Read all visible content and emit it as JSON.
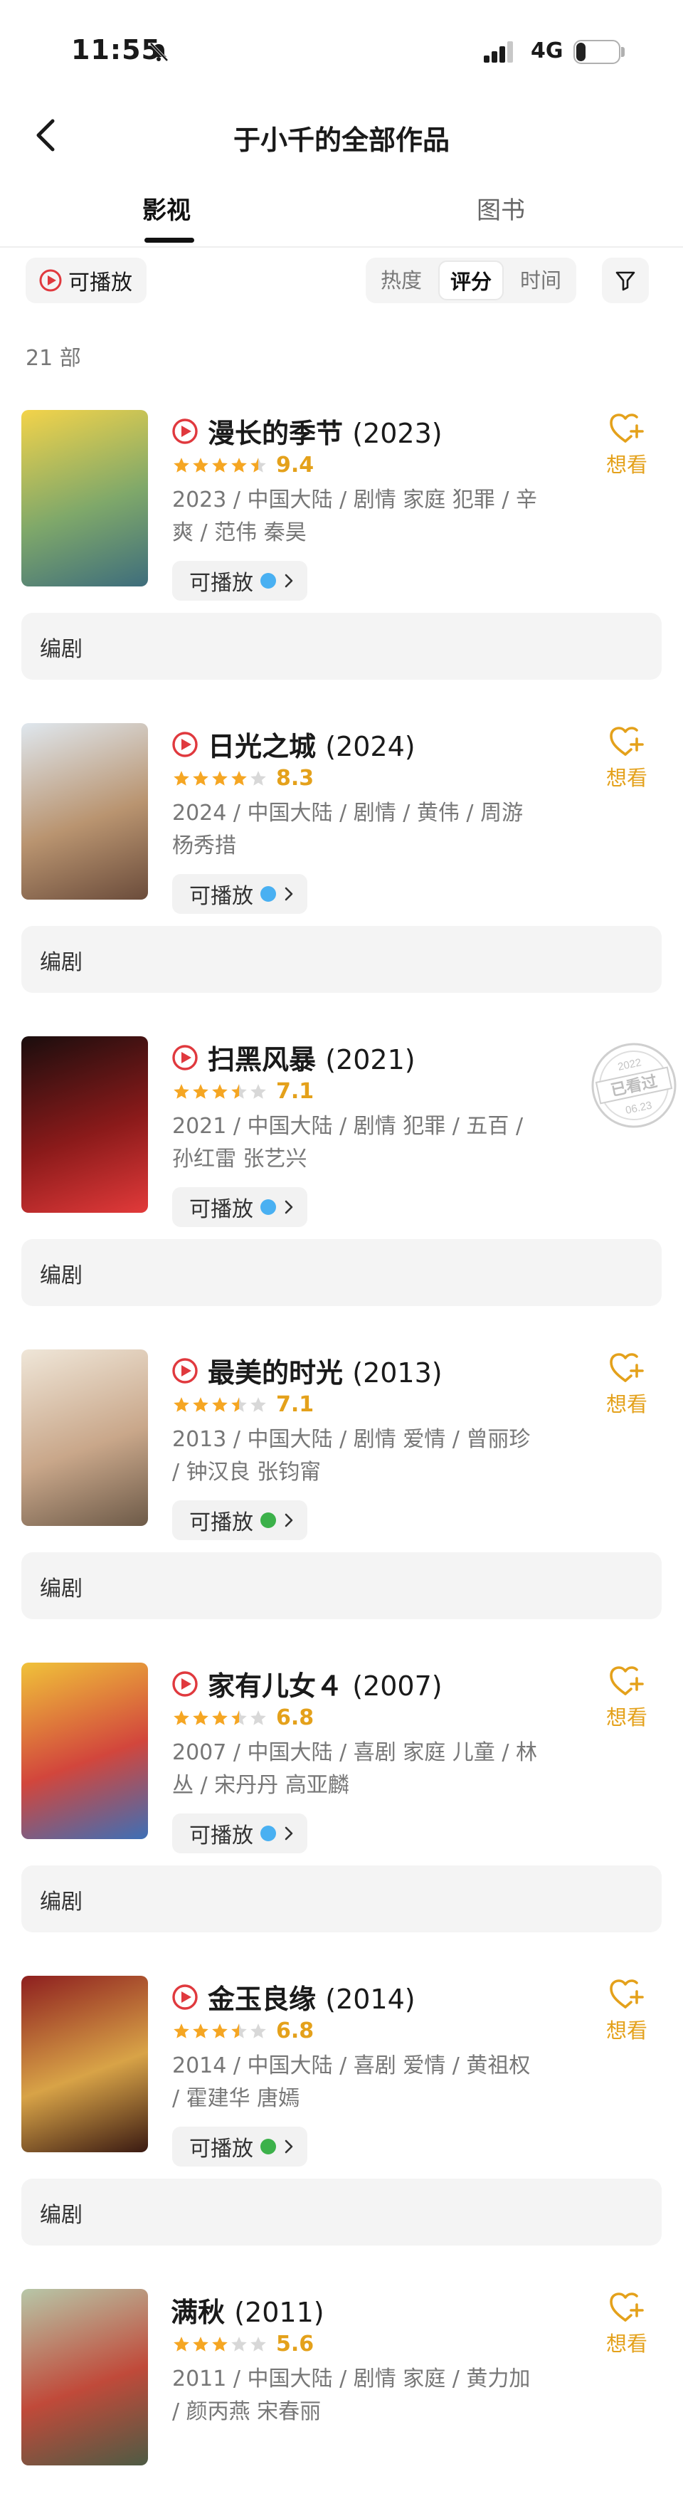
{
  "status_bar": {
    "time": "11:55",
    "network": "4G",
    "battery_level": "22",
    "icons": [
      "bell-slash-icon",
      "signal-icon",
      "battery-icon"
    ]
  },
  "nav": {
    "title": "于小千的全部作品",
    "back_icon": "chevron-left-icon"
  },
  "tabs": [
    {
      "label": "影视",
      "active": true
    },
    {
      "label": "图书",
      "active": false
    }
  ],
  "filter": {
    "playable_label": "可播放",
    "sort_options": [
      "热度",
      "评分",
      "时间"
    ],
    "selected_sort": "评分",
    "filter_icon": "funnel-icon"
  },
  "count_label": "21 部",
  "colors": {
    "accent": "#e4a11b",
    "play_red": "#e0393e",
    "star": "#f5a623",
    "star_empty": "#d8d8d8"
  },
  "works": [
    {
      "title": "漫长的季节",
      "year": "(2023)",
      "score": "9.4",
      "rating": 4.5,
      "meta": "2023 / 中国大陆 / 剧情 家庭 犯罪 / 辛爽 / 范伟 秦昊",
      "play_label": "可播放",
      "source_color": "#49b0f2",
      "show_title_play": true,
      "show_play_chip": true,
      "state": "want",
      "want_label": "想看",
      "role": "编剧",
      "poster_colors": [
        "#f3d34a",
        "#7fa86a",
        "#3e6d7c"
      ]
    },
    {
      "title": "日光之城",
      "year": "(2024)",
      "score": "8.3",
      "rating": 4.0,
      "meta": "2024 / 中国大陆 / 剧情 / 黄伟 / 周游 杨秀措",
      "play_label": "可播放",
      "source_color": "#49b0f2",
      "show_title_play": true,
      "show_play_chip": true,
      "state": "want",
      "want_label": "想看",
      "role": "编剧",
      "poster_colors": [
        "#dfe7ee",
        "#b99470",
        "#6b4c3b"
      ]
    },
    {
      "title": "扫黑风暴",
      "year": "(2021)",
      "score": "7.1",
      "rating": 3.5,
      "meta": "2021 / 中国大陆 / 剧情 犯罪 / 五百 / 孙红雷 张艺兴",
      "play_label": "可播放",
      "source_color": "#49b0f2",
      "show_title_play": true,
      "show_play_chip": true,
      "state": "seen",
      "seen_label": "已看过",
      "seen_year": "2022",
      "seen_date": "06.23",
      "role": "编剧",
      "poster_colors": [
        "#1a0d0d",
        "#8a1a1a",
        "#e23a3a"
      ]
    },
    {
      "title": "最美的时光",
      "year": "(2013)",
      "score": "7.1",
      "rating": 3.5,
      "meta": "2013 / 中国大陆 / 剧情 爱情 / 曾丽珍 / 钟汉良 张钧甯",
      "play_label": "可播放",
      "source_color": "#3cb14a",
      "show_title_play": true,
      "show_play_chip": true,
      "state": "want",
      "want_label": "想看",
      "role": "编剧",
      "poster_colors": [
        "#efe6d8",
        "#c9a78a",
        "#6d5a48"
      ]
    },
    {
      "title": "家有儿女４",
      "year": "(2007)",
      "score": "6.8",
      "rating": 3.5,
      "meta": "2007 / 中国大陆 / 喜剧 家庭 儿童 / 林丛 / 宋丹丹 高亚麟",
      "play_label": "可播放",
      "source_color": "#49b0f2",
      "show_title_play": true,
      "show_play_chip": true,
      "state": "want",
      "want_label": "想看",
      "role": "编剧",
      "poster_colors": [
        "#f0c23a",
        "#d2463c",
        "#3d6fb6"
      ]
    },
    {
      "title": "金玉良缘",
      "year": "(2014)",
      "score": "6.8",
      "rating": 3.5,
      "meta": "2014 / 中国大陆 / 喜剧 爱情 / 黄祖权 / 霍建华 唐嫣",
      "play_label": "可播放",
      "source_color": "#3cb14a",
      "show_title_play": true,
      "show_play_chip": true,
      "state": "want",
      "want_label": "想看",
      "role": "编剧",
      "poster_colors": [
        "#8e1f1f",
        "#d8a347",
        "#3a1a12"
      ]
    },
    {
      "title": "满秋",
      "year": "(2011)",
      "score": "5.6",
      "rating": 3.0,
      "meta": "2011 / 中国大陆 / 剧情 家庭 / 黄力加 / 颜丙燕 宋春丽",
      "play_label": "",
      "source_color": "",
      "show_title_play": false,
      "show_play_chip": false,
      "state": "want",
      "want_label": "想看",
      "role": "",
      "poster_colors": [
        "#b7c7a8",
        "#c04a3a",
        "#4e5b44"
      ]
    }
  ]
}
